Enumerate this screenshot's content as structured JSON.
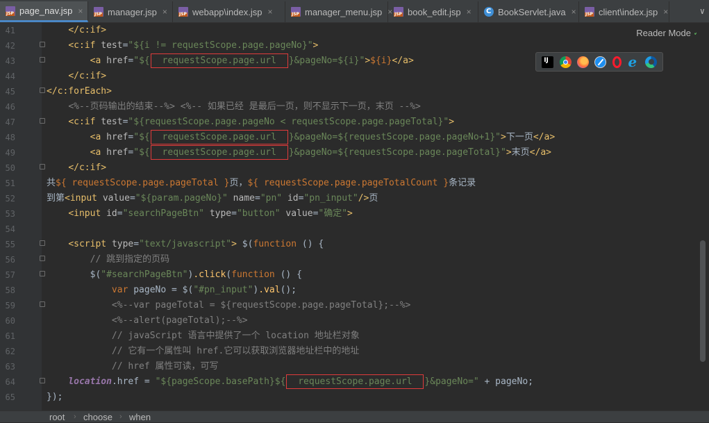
{
  "tabs": [
    {
      "label": "page_nav.jsp",
      "type": "jsp",
      "active": true
    },
    {
      "label": "manager.jsp",
      "type": "jsp",
      "active": false
    },
    {
      "label": "webapp\\index.jsp",
      "type": "jsp",
      "active": false
    },
    {
      "label": "manager_menu.jsp",
      "type": "jsp",
      "active": false
    },
    {
      "label": "book_edit.jsp",
      "type": "jsp",
      "active": false
    },
    {
      "label": "BookServlet.java",
      "type": "java",
      "active": false
    },
    {
      "label": "client\\index.jsp",
      "type": "jsp",
      "active": false
    }
  ],
  "tab_close_glyph": "×",
  "tabs_more_glyph": "∨",
  "reader_mode_label": "Reader Mode",
  "browser_icons": [
    "intellij-icon",
    "chrome-icon",
    "firefox-icon",
    "safari-icon",
    "opera-icon",
    "ie-icon",
    "edge-icon"
  ],
  "code": {
    "line_numbers": [
      "41",
      "42",
      "43",
      "44",
      "45",
      "46",
      "47",
      "48",
      "49",
      "50",
      "51",
      "52",
      "53",
      "54",
      "55",
      "56",
      "57",
      "58",
      "59",
      "60",
      "61",
      "62",
      "63",
      "64",
      "65"
    ],
    "lines": [
      "        </c:if>",
      "        <c:if test=\"${i != requestScope.page.pageNo}\">",
      "            <a href=\"${ requestScope.page.url }&pageNo=${i}\">${i}</a>",
      "        </c:if>",
      "    </c:forEach>",
      "        <%--页码输出的结束--%> <%-- 如果已经 是最后一页，则不显示下一页，末页 --%>",
      "        <c:if test=\"${requestScope.page.pageNo < requestScope.page.pageTotal}\">",
      "            <a href=\"${ requestScope.page.url }&pageNo=${requestScope.page.pageNo+1}\">下一页</a>",
      "            <a href=\"${ requestScope.page.url }&pageNo=${requestScope.page.pageTotal}\">末页</a>",
      "        </c:if>",
      "    共${ requestScope.page.pageTotal }页，${ requestScope.page.pageTotalCount }条记录",
      "    到第<input value=\"${param.pageNo}\" name=\"pn\" id=\"pn_input\"/>页",
      "        <input id=\"searchPageBtn\" type=\"button\" value=\"确定\">",
      "",
      "        <script type=\"text/javascript\"> $(function () {",
      "            // 跳到指定的页码",
      "            $(\"#searchPageBtn\").click(function () {",
      "                var pageNo = $(\"#pn_input\").val();",
      "                <%--var pageTotal = ${requestScope.page.pageTotal};--%>",
      "                <%--alert(pageTotal);--%>",
      "                // javaScript 语言中提供了一个 location 地址栏对象",
      "                // 它有一个属性叫 href.它可以获取浏览器地址栏中的地址",
      "                // href 属性可读，可写",
      "        location.href = \"${pageScope.basePath}${ requestScope.page.url }&pageNo=\" + pageNo;",
      "    });"
    ]
  },
  "breadcrumb": [
    "root",
    "choose",
    "when"
  ],
  "breadcrumb_sep": "›",
  "colors": {
    "editor_bg": "#2b2b2b",
    "tag": "#e8bf6a",
    "string": "#6a8759",
    "keyword": "#cc7832",
    "comment": "#808080",
    "highlight_box": "#e03b3b",
    "active_tab_underline": "#4a88c7"
  }
}
